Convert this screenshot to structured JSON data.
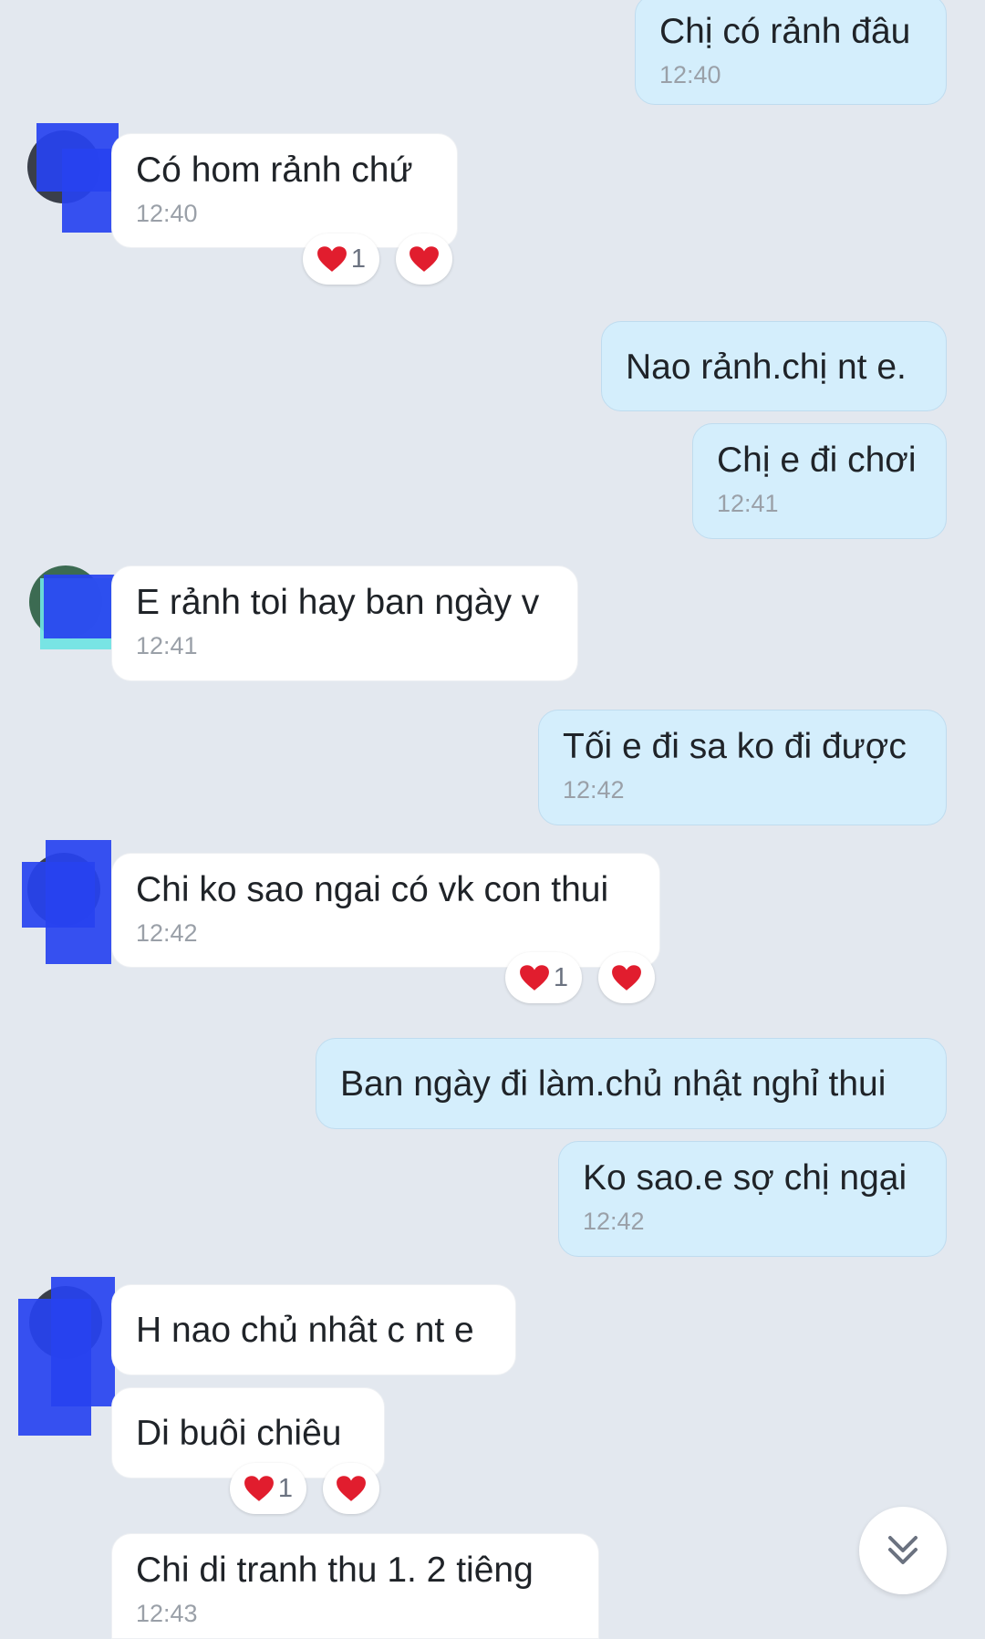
{
  "messages": [
    {
      "text": "Chị có rảnh đâu",
      "time": "12:40"
    },
    {
      "text": "Có hom rảnh chứ",
      "time": "12:40",
      "reaction_count": "1"
    },
    {
      "text": "Nao rảnh.chị nt e."
    },
    {
      "text": "Chị e đi chơi",
      "time": "12:41"
    },
    {
      "text": "E rảnh toi hay ban ngày v",
      "time": "12:41"
    },
    {
      "text": "Tối e đi sa ko đi được",
      "time": "12:42"
    },
    {
      "text": "Chi ko sao ngai có vk con thui",
      "time": "12:42",
      "reaction_count": "1"
    },
    {
      "text": "Ban ngày đi làm.chủ nhật nghỉ thui"
    },
    {
      "text": "Ko sao.e sợ chị ngại",
      "time": "12:42"
    },
    {
      "text": "H nao chủ nhât c nt e"
    },
    {
      "text": "Di buôi chiêu",
      "reaction_count": "1"
    },
    {
      "text": "Chi di tranh thu 1.  2 tiêng",
      "time": "12:43"
    }
  ],
  "colors": {
    "outgoing_bubble": "#d4eefc",
    "incoming_bubble": "#ffffff",
    "background": "#e3e8ef",
    "heart": "#e11d2e"
  },
  "icons": {
    "reaction": "heart-icon",
    "scroll": "double-chevron-down-icon"
  }
}
